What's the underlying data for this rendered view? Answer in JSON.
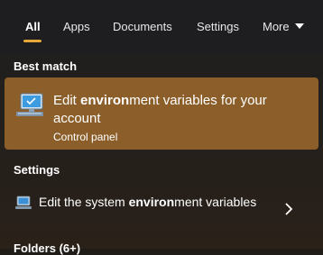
{
  "tabs": [
    {
      "label": "All"
    },
    {
      "label": "Apps"
    },
    {
      "label": "Documents"
    },
    {
      "label": "Settings"
    },
    {
      "label": "More"
    }
  ],
  "best_match": {
    "header": "Best match",
    "title_pre": "Edit ",
    "title_bold": "environ",
    "title_post": "ment variables for your account",
    "subtitle": "Control panel"
  },
  "settings": {
    "header": "Settings",
    "item_pre": "Edit the system ",
    "item_bold": "environ",
    "item_post": "ment variables"
  },
  "folders": {
    "header": "Folders (6+)"
  },
  "colors": {
    "accent": "#e7a83a",
    "highlight": "#8c5f2a",
    "background": "#201c18"
  }
}
